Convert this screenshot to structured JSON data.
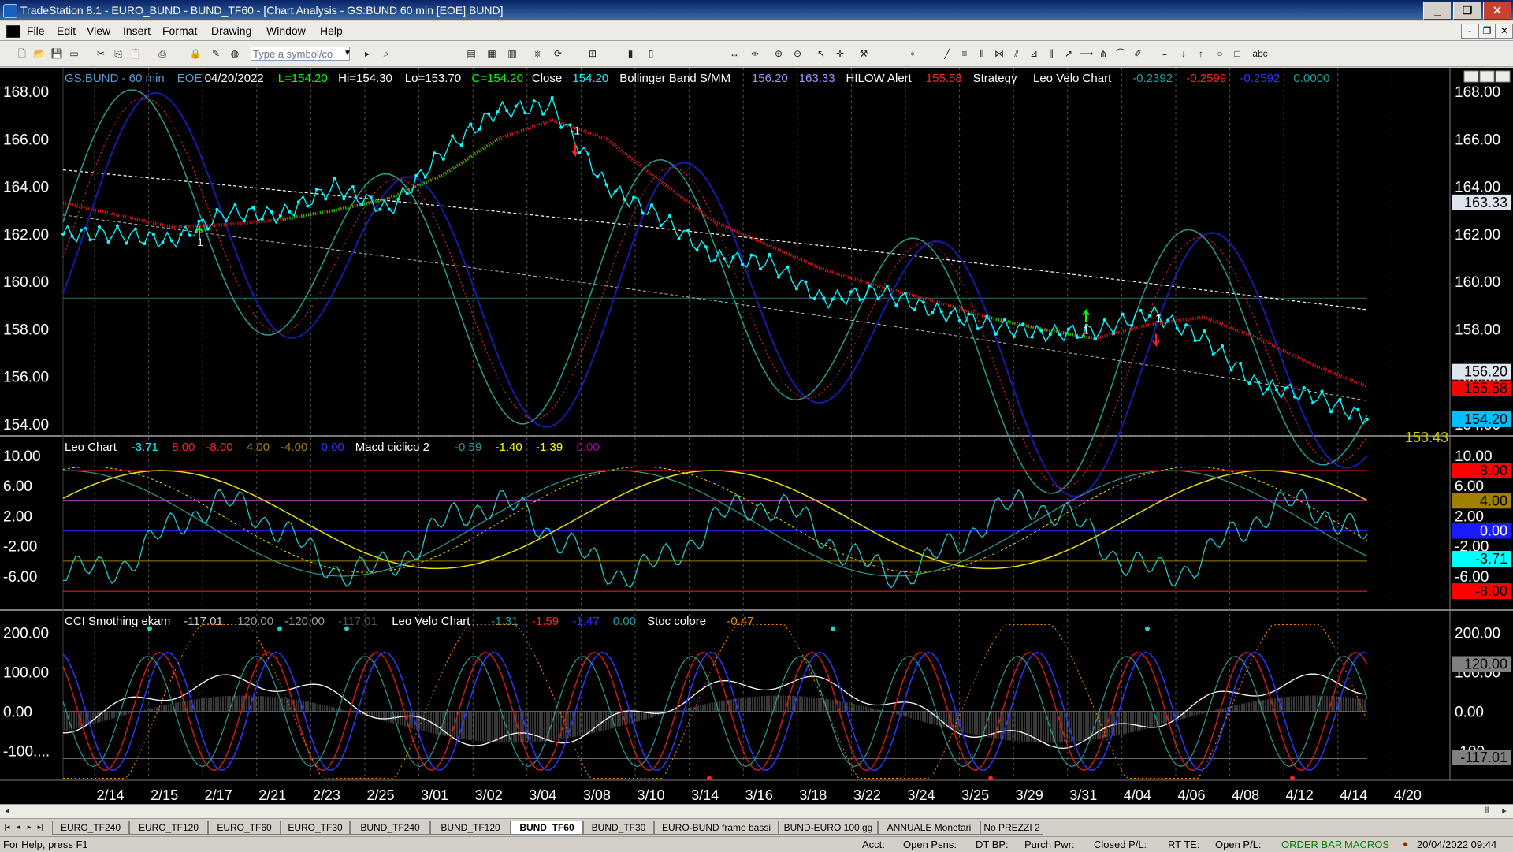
{
  "window": {
    "title": "TradeStation 8.1 - EURO_BUND - BUND_TF60 - [Chart Analysis - GS:BUND  60 min  [EOE] BUND]"
  },
  "window_buttons": {
    "minimize": "_",
    "restore": "❐",
    "close": "✕"
  },
  "menu": [
    "File",
    "Edit",
    "View",
    "Insert",
    "Format",
    "Drawing",
    "Window",
    "Help"
  ],
  "mdi_buttons": {
    "minimize": "-",
    "restore": "❐",
    "close": "✕"
  },
  "toolbar": {
    "symbol_placeholder": "Type a symbol/co",
    "abc_label": "abc"
  },
  "status": {
    "help": "For Help, press F1",
    "acct": "Acct:",
    "open_psns": "Open Psns:",
    "dt_bp": "DT BP:",
    "purch_pwr": "Purch Pwr:",
    "closed_pl": "Closed P/L:",
    "rt_te": "RT TE:",
    "open_pl": "Open P/L:",
    "order_bar": "ORDER BAR",
    "macros": "MACROS",
    "datetime": "20/04/2022 09:44"
  },
  "tabs": [
    "EURO_TF240",
    "EURO_TF120",
    "EURO_TF60",
    "EURO_TF30",
    "BUND_TF240",
    "BUND_TF120",
    "BUND_TF60",
    "BUND_TF30",
    "EURO-BUND frame bassi",
    "BUND-EURO 100 gg",
    "ANNUALE Monetari",
    "No PREZZI 2"
  ],
  "active_tab": "BUND_TF60",
  "colors": {
    "bg": "#000000",
    "price": "#00ffff",
    "bb_mid": "#ffffff",
    "bb_band": "#1a1aaa",
    "osc_teal": "#2a9d8f",
    "hilow_red": "#ff1a1a",
    "hilow_green": "#00e000",
    "leo_red": "#cc1a1a",
    "cyan_line": "#22c8c8",
    "yellow": "#e8e000",
    "white": "#ffffff"
  },
  "panes": [
    {
      "id": "price",
      "legend": [
        {
          "text": "GS:BUND - 60 min",
          "color": "#5a9bd5"
        },
        {
          "text": "EOE",
          "color": "#5a9bd5"
        },
        {
          "text": "04/20/2022",
          "color": "#ffffff"
        },
        {
          "text": "L=154.20",
          "color": "#00ff00"
        },
        {
          "text": "Hi=154.30",
          "color": "#ffffff"
        },
        {
          "text": "Lo=153.70",
          "color": "#ffffff"
        },
        {
          "text": "C=154.20",
          "color": "#00ff00"
        },
        {
          "text": "Close",
          "color": "#ffffff"
        },
        {
          "text": "154.20",
          "color": "#00ffff"
        },
        {
          "text": "Bollinger Band S/MM",
          "color": "#ffffff"
        },
        {
          "text": "156.20",
          "color": "#9999ff"
        },
        {
          "text": "163.33",
          "color": "#9999ff"
        },
        {
          "text": "HILOW Alert",
          "color": "#ffffff"
        },
        {
          "text": "155.58",
          "color": "#ff2020"
        },
        {
          "text": "Strategy",
          "color": "#ffffff"
        },
        {
          "text": "Leo Velo Chart",
          "color": "#ffffff"
        },
        {
          "text": "-0.2392",
          "color": "#1ea0a0"
        },
        {
          "text": "-0.2599",
          "color": "#ff2020"
        },
        {
          "text": "-0.2592",
          "color": "#3333ff"
        },
        {
          "text": "0.0000",
          "color": "#1ea0a0"
        }
      ],
      "yticks": [
        "168.00",
        "166.00",
        "164.00",
        "162.00",
        "160.00",
        "158.00",
        "156.00",
        "154.00"
      ],
      "ytick_values": [
        168,
        166,
        164,
        162,
        160,
        158,
        156,
        154
      ],
      "value_tags": [
        {
          "text": "163.33",
          "value": 163.33,
          "bg": "#dde6ee",
          "fg": "#000000"
        },
        {
          "text": "156.20",
          "value": 156.2,
          "bg": "#dde6ee",
          "fg": "#000000"
        },
        {
          "text": "155.58",
          "value": 155.5,
          "bg": "#ff0000",
          "fg": "#000000"
        },
        {
          "text": "154.20",
          "value": 154.2,
          "bg": "#00bfff",
          "fg": "#000000"
        }
      ],
      "last_label": {
        "text": "153.43",
        "value": 153.43,
        "color": "#cccc00"
      },
      "annotations": [
        "1",
        "-1",
        "1",
        "1"
      ]
    },
    {
      "id": "leo",
      "legend": [
        {
          "text": "Leo Chart",
          "color": "#ffffff"
        },
        {
          "text": "-3.71",
          "color": "#00ffff"
        },
        {
          "text": "8.00",
          "color": "#ff2020"
        },
        {
          "text": "-8.00",
          "color": "#ff2020"
        },
        {
          "text": "4.00",
          "color": "#a08000"
        },
        {
          "text": "-4.00",
          "color": "#a08000"
        },
        {
          "text": "0.00",
          "color": "#3333ff"
        },
        {
          "text": "Macd ciclico 2",
          "color": "#ffffff"
        },
        {
          "text": "-0.59",
          "color": "#1ea0a0"
        },
        {
          "text": "-1.40",
          "color": "#ffff00"
        },
        {
          "text": "-1.39",
          "color": "#ffff00"
        },
        {
          "text": "0.00",
          "color": "#aa00aa"
        }
      ],
      "yticks": [
        "10.00",
        "6.00",
        "2.00",
        "-2.00",
        "-6.00"
      ],
      "ytick_values": [
        10,
        6,
        2,
        -2,
        -6
      ],
      "value_tags": [
        {
          "text": "8.00",
          "value": 8,
          "bg": "#ff0000",
          "fg": "#000000"
        },
        {
          "text": "4.00",
          "value": 4,
          "bg": "#a08000",
          "fg": "#000000"
        },
        {
          "text": "0.00",
          "value": 0,
          "bg": "#1a1aff",
          "fg": "#ffffff"
        },
        {
          "text": "-3.71",
          "value": -3.71,
          "bg": "#00ffff",
          "fg": "#000000"
        },
        {
          "text": "-8.00",
          "value": -8,
          "bg": "#ff0000",
          "fg": "#000000"
        }
      ]
    },
    {
      "id": "cci",
      "legend": [
        {
          "text": "CCI Smothing ekam",
          "color": "#ffffff"
        },
        {
          "text": "-117.01",
          "color": "#cccccc"
        },
        {
          "text": "120.00",
          "color": "#999999"
        },
        {
          "text": "-120.00",
          "color": "#999999"
        },
        {
          "text": "-117.01",
          "color": "#555555"
        },
        {
          "text": "Leo Velo Chart",
          "color": "#ffffff"
        },
        {
          "text": "-1.31",
          "color": "#1ea0a0"
        },
        {
          "text": "-1.59",
          "color": "#ff2020"
        },
        {
          "text": "-1.47",
          "color": "#3333ff"
        },
        {
          "text": "0.00",
          "color": "#1ea0a0"
        },
        {
          "text": "Stoc colore",
          "color": "#ffffff"
        },
        {
          "text": "-0.47",
          "color": "#ff8800"
        }
      ],
      "yticks": [
        "200.00",
        "100.00",
        "0.00",
        "-100...."
      ],
      "ytick_values": [
        200,
        100,
        0,
        -100
      ],
      "value_tags": [
        {
          "text": "120.00",
          "value": 120,
          "bg": "#808080",
          "fg": "#000000"
        },
        {
          "text": "-117.01",
          "value": -117.01,
          "bg": "#808080",
          "fg": "#000000"
        }
      ]
    }
  ],
  "x_dates": [
    "2/14",
    "2/15",
    "2/17",
    "2/21",
    "2/23",
    "2/25",
    "3/01",
    "3/02",
    "3/04",
    "3/08",
    "3/10",
    "3/14",
    "3/16",
    "3/18",
    "3/22",
    "3/24",
    "3/25",
    "3/29",
    "3/31",
    "4/04",
    "4/06",
    "4/08",
    "4/12",
    "4/14",
    "4/20"
  ],
  "chart_data": {
    "type": "line",
    "symbol": "GS:BUND",
    "interval": "60 min",
    "date_labels": [
      "2/14",
      "2/15",
      "2/17",
      "2/21",
      "2/23",
      "2/25",
      "3/01",
      "3/02",
      "3/04",
      "3/08",
      "3/10",
      "3/14",
      "3/16",
      "3/18",
      "3/22",
      "3/24",
      "3/25",
      "3/29",
      "3/31",
      "4/04",
      "4/06",
      "4/08",
      "4/12",
      "4/14",
      "4/20"
    ],
    "series": [
      {
        "name": "Close",
        "values": [
          162.0,
          162.0,
          161.7,
          162.9,
          162.8,
          164.0,
          163.0,
          165.5,
          167.2,
          167.4,
          164.0,
          162.7,
          161.0,
          160.8,
          159.2,
          159.6,
          158.8,
          158.2,
          157.8,
          157.9,
          158.7,
          157.6,
          155.6,
          155.2,
          154.2
        ]
      },
      {
        "name": "HILOW Alert",
        "values": [
          163.3,
          162.8,
          162.3,
          162.4,
          162.6,
          163.0,
          163.5,
          164.5,
          166.0,
          166.8,
          166.0,
          164.2,
          162.5,
          161.5,
          160.5,
          159.8,
          159.2,
          158.5,
          158.0,
          157.6,
          158.2,
          158.5,
          157.6,
          156.5,
          155.58
        ]
      }
    ],
    "ylim": [
      153.5,
      169
    ]
  }
}
